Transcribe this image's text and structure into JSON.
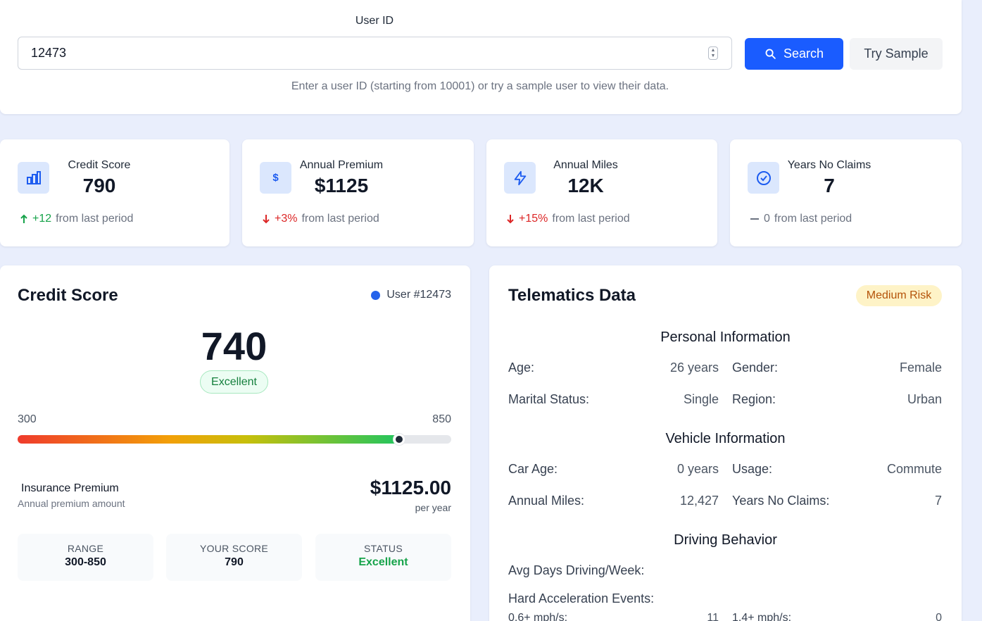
{
  "search": {
    "label": "User ID",
    "value": "12473",
    "search_label": "Search",
    "sample_label": "Try Sample",
    "helper": "Enter a user ID (starting from 10001) or try a sample user to view their data."
  },
  "stats": [
    {
      "icon": "bar-chart-icon",
      "label": "Credit Score",
      "value": "790",
      "direction": "up",
      "change": "+12",
      "suffix": "from last period"
    },
    {
      "icon": "dollar-icon",
      "label": "Annual Premium",
      "value": "$1125",
      "direction": "down",
      "change": "+3%",
      "suffix": "from last period"
    },
    {
      "icon": "lightning-icon",
      "label": "Annual Miles",
      "value": "12K",
      "direction": "down",
      "change": "+15%",
      "suffix": "from last period"
    },
    {
      "icon": "check-circle-icon",
      "label": "Years No Claims",
      "value": "7",
      "direction": "flat",
      "change": "0",
      "suffix": "from last period"
    }
  ],
  "credit": {
    "title": "Credit Score",
    "user_tag": "User #12473",
    "score": "740",
    "rating": "Excellent",
    "range_min": "300",
    "range_max": "850",
    "bar_fraction": 0.88,
    "premium_title": "Insurance Premium",
    "premium_subtitle": "Annual premium amount",
    "premium_amount": "$1125.00",
    "premium_unit": "per year",
    "summary": [
      {
        "label": "RANGE",
        "value": "300-850"
      },
      {
        "label": "YOUR SCORE",
        "value": "790"
      },
      {
        "label": "STATUS",
        "value": "Excellent"
      }
    ]
  },
  "telematics": {
    "title": "Telematics Data",
    "risk": "Medium Risk",
    "personal_heading": "Personal Information",
    "age_label": "Age:",
    "age_value": "26 years",
    "gender_label": "Gender:",
    "gender_value": "Female",
    "marital_label": "Marital Status:",
    "marital_value": "Single",
    "region_label": "Region:",
    "region_value": "Urban",
    "vehicle_heading": "Vehicle Information",
    "car_age_label": "Car Age:",
    "car_age_value": "0 years",
    "usage_label": "Usage:",
    "usage_value": "Commute",
    "miles_label": "Annual Miles:",
    "miles_value": "12,427",
    "claims_label": "Years No Claims:",
    "claims_value": "7",
    "driving_heading": "Driving Behavior",
    "days_label": "Avg Days Driving/Week:",
    "hard_accel_label": "Hard Acceleration Events:",
    "accel_low_label": "0.6+ mph/s:",
    "accel_low_value": "11",
    "accel_high_label": "1.4+ mph/s:",
    "accel_high_value": "0"
  },
  "colors": {
    "primary": "#1a5cff",
    "success": "#16a34a",
    "danger": "#dc2626",
    "warning_bg": "#fef3c7",
    "warning_text": "#b45309"
  }
}
